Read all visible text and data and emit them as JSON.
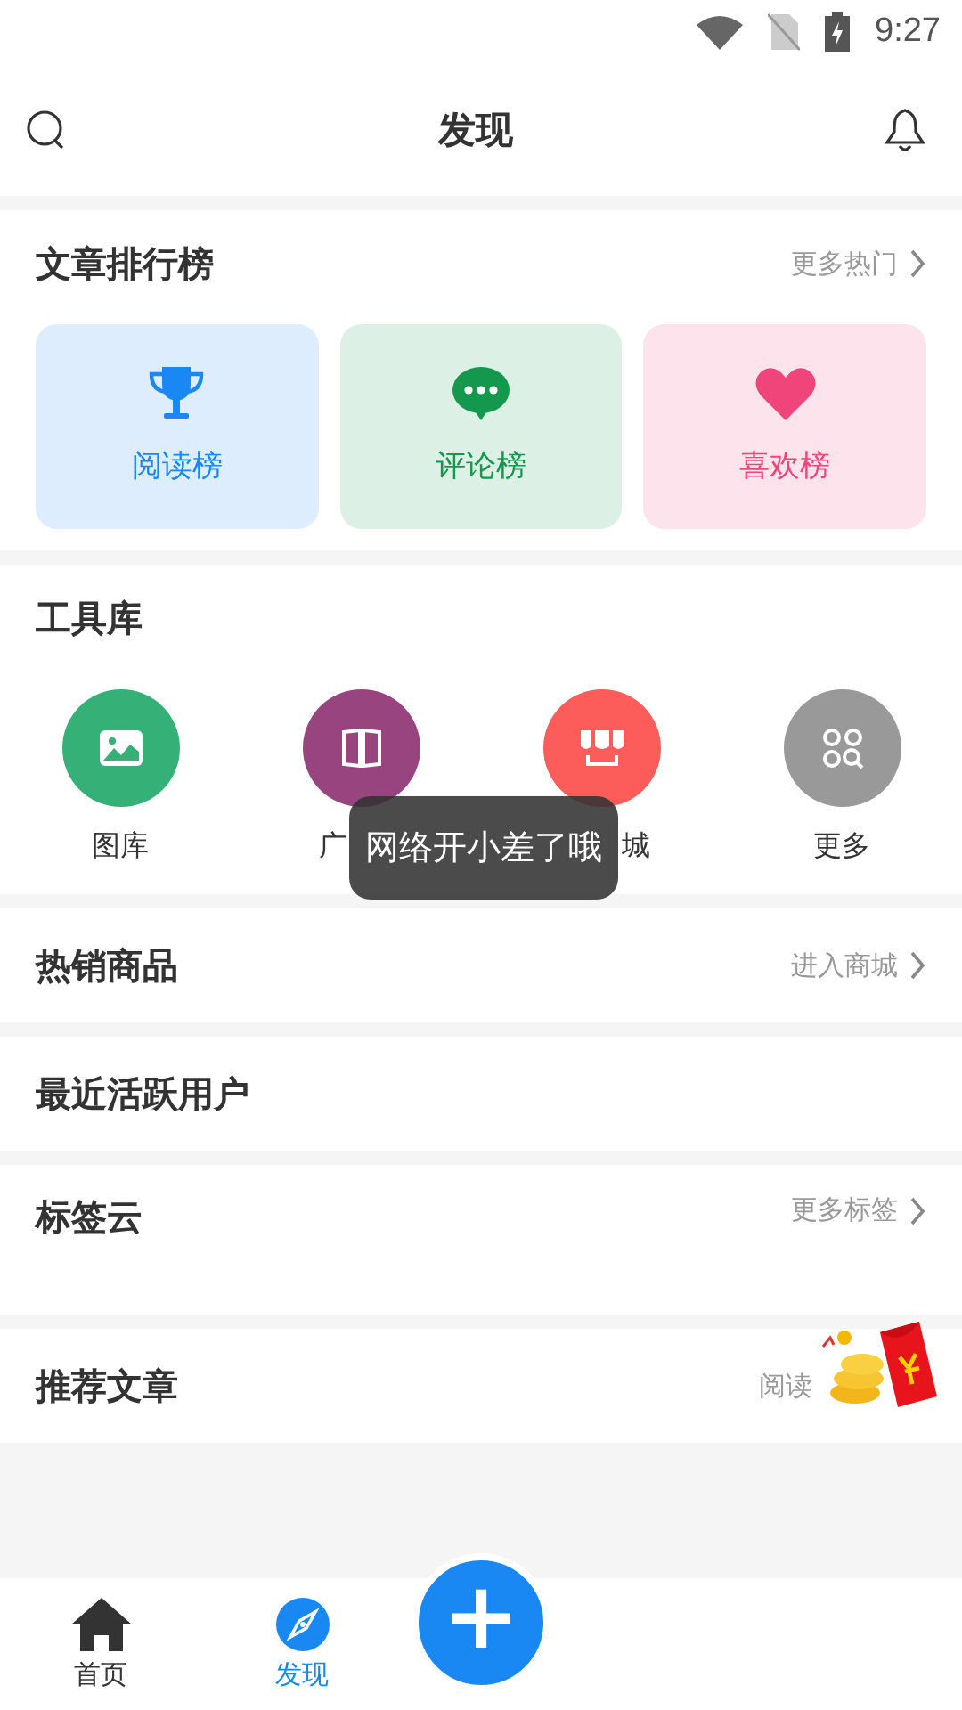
{
  "status_bar": {
    "time": "9:27"
  },
  "header": {
    "title": "发现"
  },
  "ranking": {
    "title": "文章排行榜",
    "more": "更多热门",
    "cards": [
      {
        "kind": "trophy",
        "label": "阅读榜",
        "color": "#1a88f2"
      },
      {
        "kind": "comment",
        "label": "评论榜",
        "color": "#14984e"
      },
      {
        "kind": "heart",
        "label": "喜欢榜",
        "color": "#f0457a"
      }
    ]
  },
  "tools": {
    "title": "工具库",
    "items": [
      {
        "kind": "gallery",
        "label": "图库",
        "color": "#35b076"
      },
      {
        "kind": "book",
        "label": "广",
        "color": "#98447e"
      },
      {
        "kind": "shop",
        "label": "城",
        "color": "#fd5d5a"
      },
      {
        "kind": "more",
        "label": "更多",
        "color": "#999999"
      }
    ]
  },
  "sections": [
    {
      "title": "热销商品",
      "more": "进入商城"
    },
    {
      "title": "最近活跃用户"
    },
    {
      "title": "标签云",
      "more": "更多标签"
    },
    {
      "title": "推荐文章",
      "more": "阅读",
      "promo": true
    }
  ],
  "toast": "网络开小差了哦",
  "bottom_nav": {
    "tabs": [
      {
        "kind": "home",
        "label": "首页",
        "selected": false
      },
      {
        "kind": "compass",
        "label": "发现",
        "selected": true
      }
    ],
    "fab": "+"
  }
}
